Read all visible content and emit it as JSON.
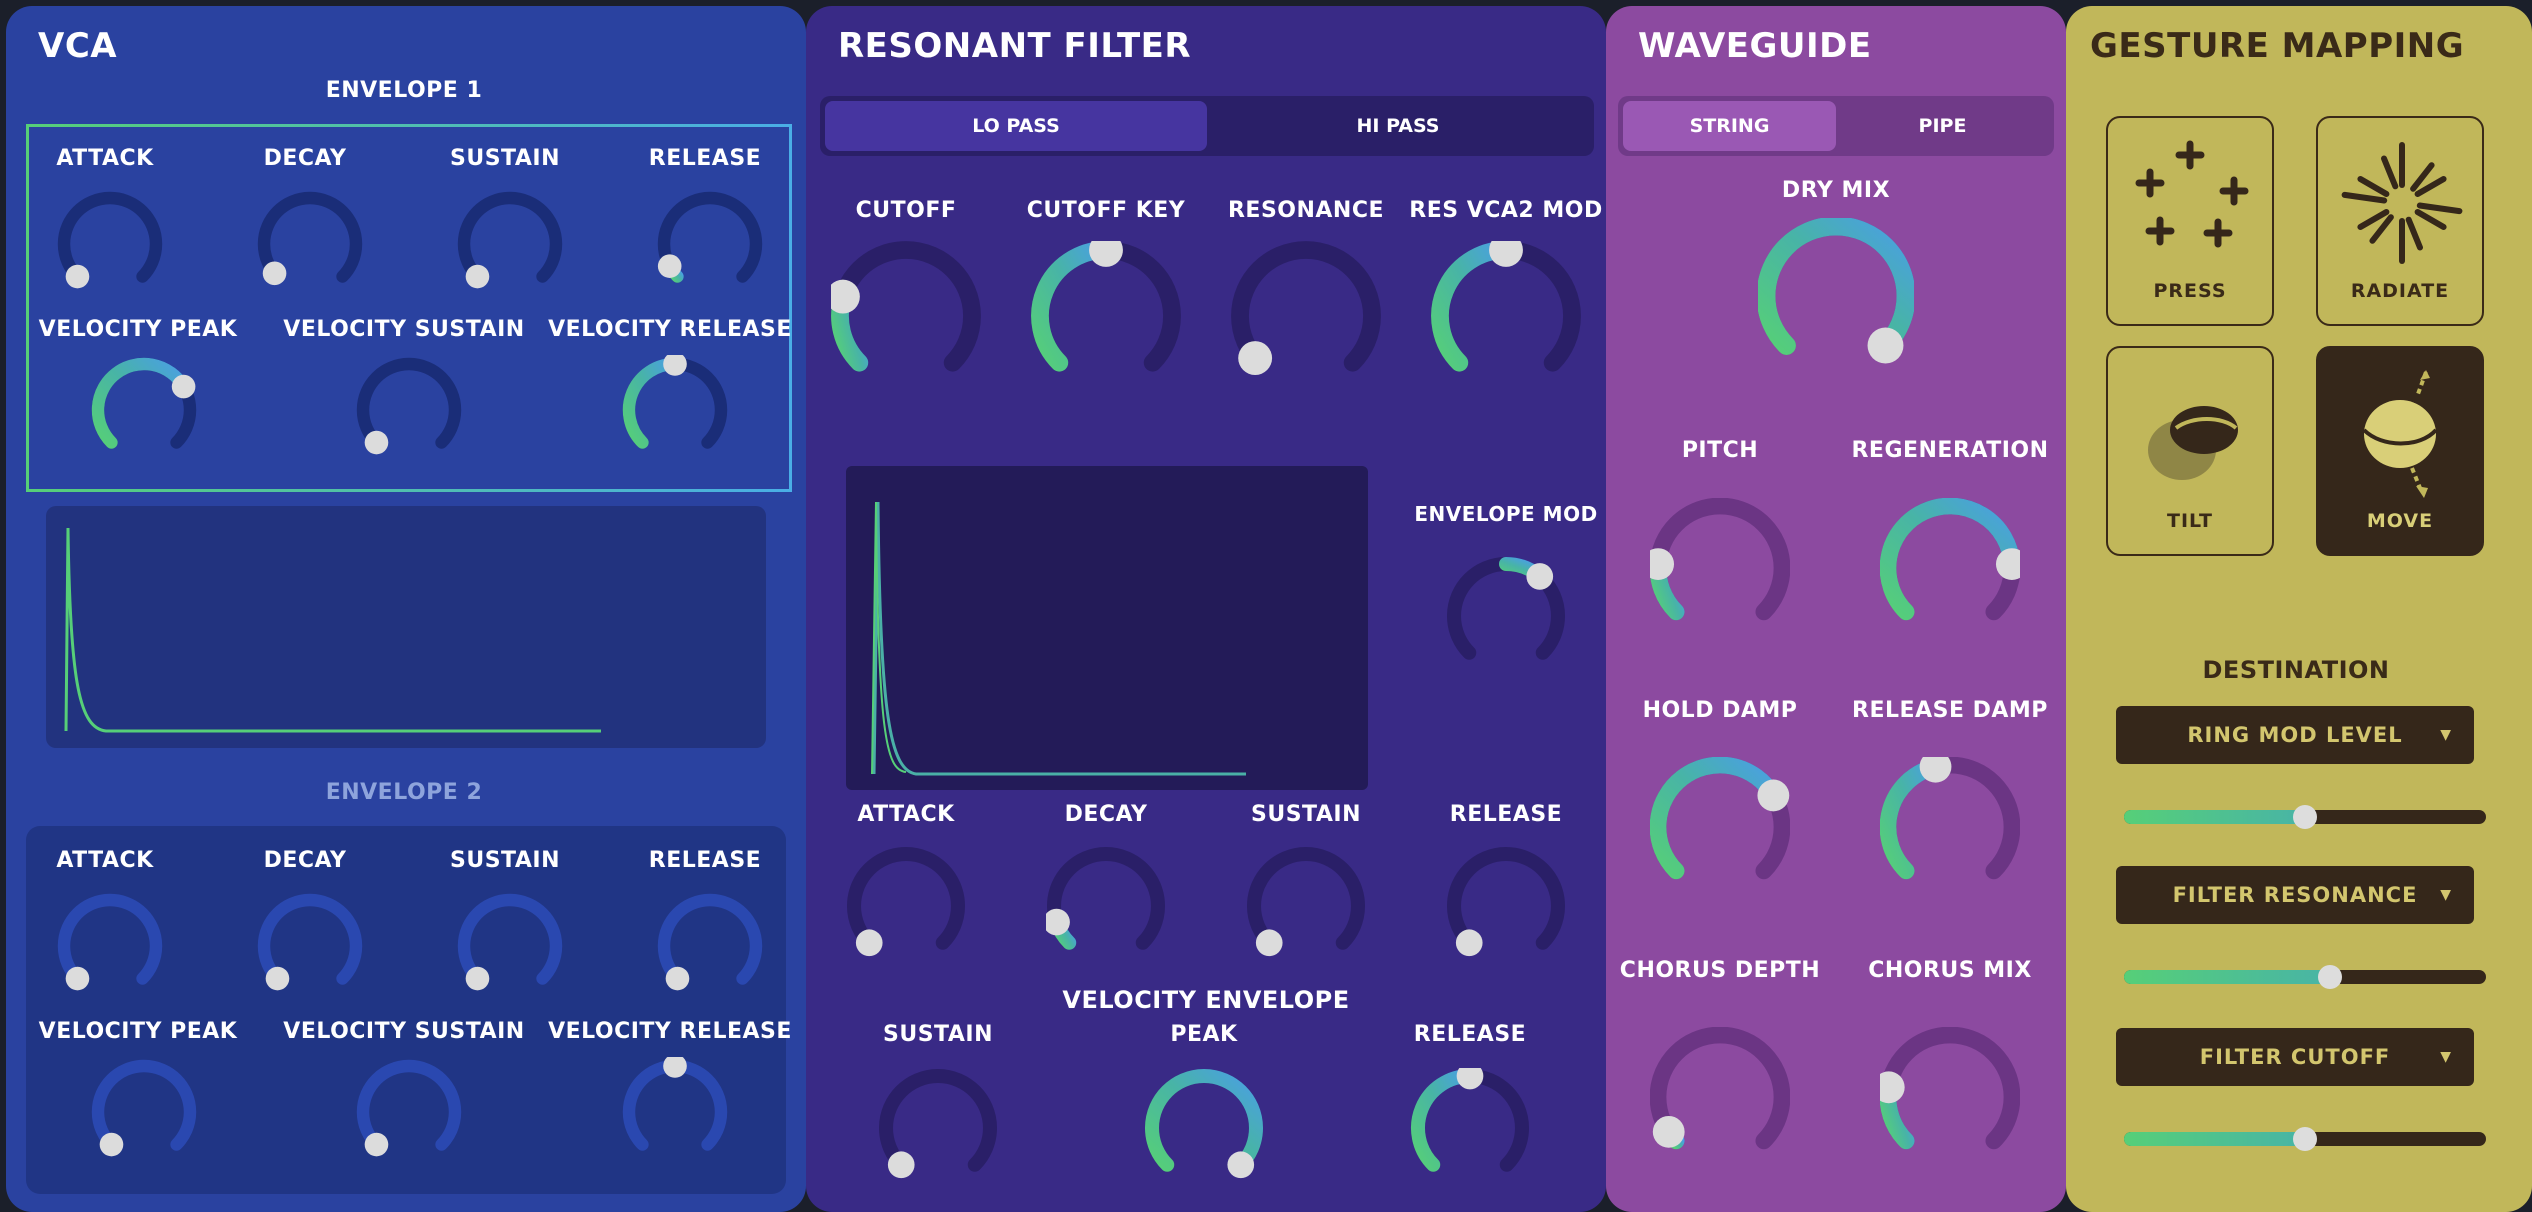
{
  "vca": {
    "title": "VCA",
    "env1": {
      "title": "ENVELOPE 1",
      "row1": [
        "ATTACK",
        "DECAY",
        "SUSTAIN",
        "RELEASE"
      ],
      "row2": [
        "VELOCITY PEAK",
        "VELOCITY SUSTAIN",
        "VELOCITY RELEASE"
      ]
    },
    "env2": {
      "title": "ENVELOPE 2",
      "row1": [
        "ATTACK",
        "DECAY",
        "SUSTAIN",
        "RELEASE"
      ],
      "row2": [
        "VELOCITY PEAK",
        "VELOCITY SUSTAIN",
        "VELOCITY RELEASE"
      ]
    }
  },
  "filter": {
    "title": "RESONANT FILTER",
    "tabs": [
      "LO PASS",
      "HI PASS"
    ],
    "selected_tab": "LO PASS",
    "knobs": [
      "CUTOFF",
      "CUTOFF KEY",
      "RESONANCE",
      "RES VCA2 MOD"
    ],
    "envelope_mod": "ENVELOPE MOD",
    "env_knobs": [
      "ATTACK",
      "DECAY",
      "SUSTAIN",
      "RELEASE"
    ],
    "velocity_envelope": "VELOCITY ENVELOPE",
    "vel_knobs": [
      "SUSTAIN",
      "PEAK",
      "RELEASE"
    ]
  },
  "waveguide": {
    "title": "WAVEGUIDE",
    "tabs": [
      "STRING",
      "PIPE"
    ],
    "selected_tab": "STRING",
    "dry_mix": "DRY MIX",
    "knobs": [
      "PITCH",
      "REGENERATION",
      "HOLD DAMP",
      "RELEASE DAMP",
      "CHORUS DEPTH",
      "CHORUS MIX"
    ]
  },
  "gesture": {
    "title": "GESTURE MAPPING",
    "buttons": [
      "PRESS",
      "RADIATE",
      "TILT",
      "MOVE"
    ],
    "active_button": "MOVE",
    "destination_label": "DESTINATION",
    "destinations": [
      {
        "label": "RING MOD LEVEL",
        "value": 0.5
      },
      {
        "label": "FILTER RESONANCE",
        "value": 0.57
      },
      {
        "label": "FILTER CUTOFF",
        "value": 0.5
      }
    ]
  },
  "colors": {
    "vca_bg": "#2a42a0",
    "filter_bg": "#392a86",
    "waveguide_bg": "#8c4aa0",
    "gesture_bg": "#c1b75a",
    "accent_green": "#56cf78",
    "accent_blue": "#4a9ee6"
  }
}
